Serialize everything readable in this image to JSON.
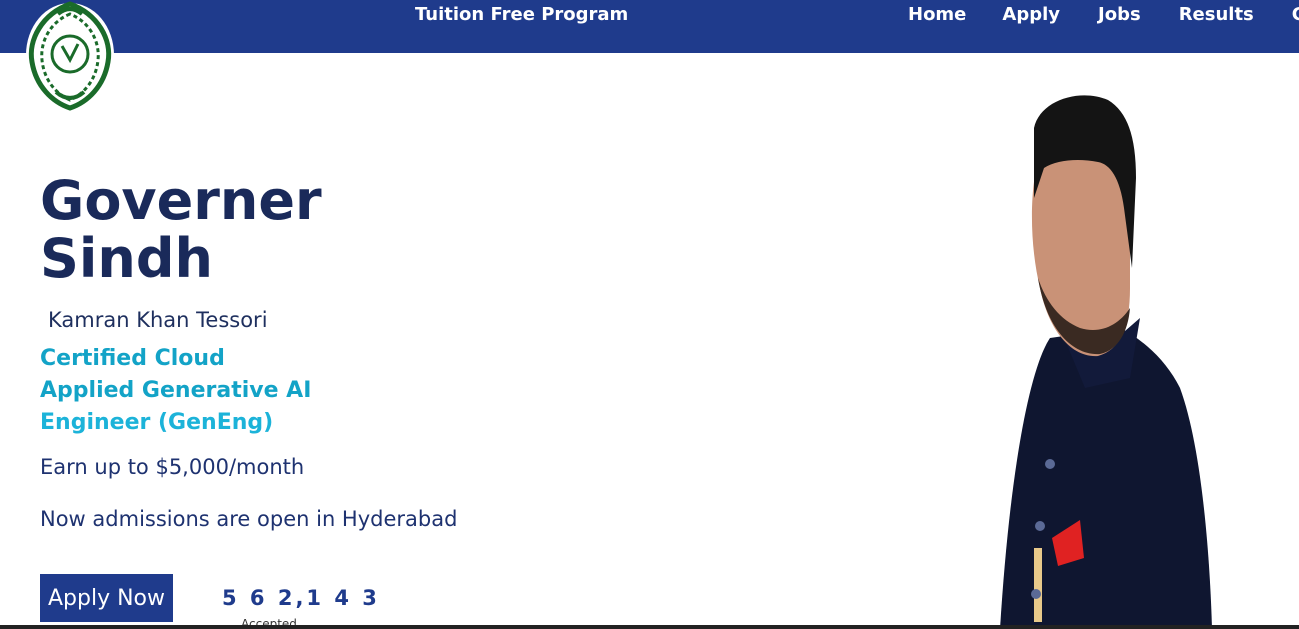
{
  "nav": {
    "title": "Tuition Free Program",
    "links": [
      "Home",
      "Apply",
      "Jobs",
      "Results",
      "Co"
    ]
  },
  "hero": {
    "title_line1": "Governer",
    "title_line2": "Sindh",
    "name": "Kamran Khan Tessori",
    "cert_line1": "Certified Cloud",
    "cert_line2": "Applied Generative AI",
    "cert_line3": "Engineer (GenEng)",
    "earn": "Earn up to $5,000/month",
    "admission": "Now admissions are open in Hyderabad",
    "apply_label": "Apply Now",
    "counter": "5 6 2,1 4 3",
    "counter_label": "Accepted"
  },
  "colors": {
    "navbar": "#1f3b8c",
    "title": "#1a2a5a",
    "accent": "#13a3c7"
  },
  "icons": {
    "logo": "governor-house-emblem",
    "portrait": "governor-portrait"
  }
}
